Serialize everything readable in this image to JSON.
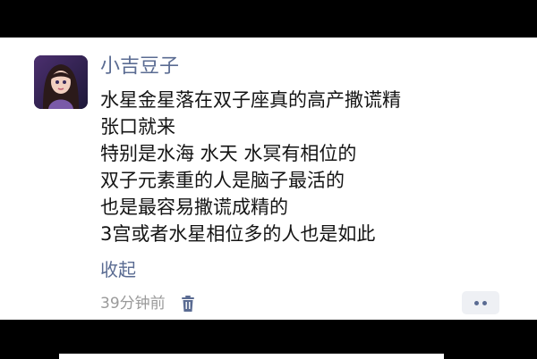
{
  "post": {
    "username": "小吉豆子",
    "lines": [
      "水星金星落在双子座真的高产撒谎精",
      "张口就来",
      "特别是水海 水天 水冥有相位的",
      "双子元素重的人是脑子最活的",
      "也是最容易撒谎成精的",
      "3宫或者水星相位多的人也是如此"
    ],
    "collapse_label": "收起",
    "timestamp": "39分钟前",
    "delete_icon": "trash-icon",
    "more_icon": "more-icon"
  },
  "colors": {
    "background": "#000000",
    "card": "#ffffff",
    "name_link": "#5a6b92",
    "text": "#141414",
    "meta": "#9a9a9a"
  }
}
